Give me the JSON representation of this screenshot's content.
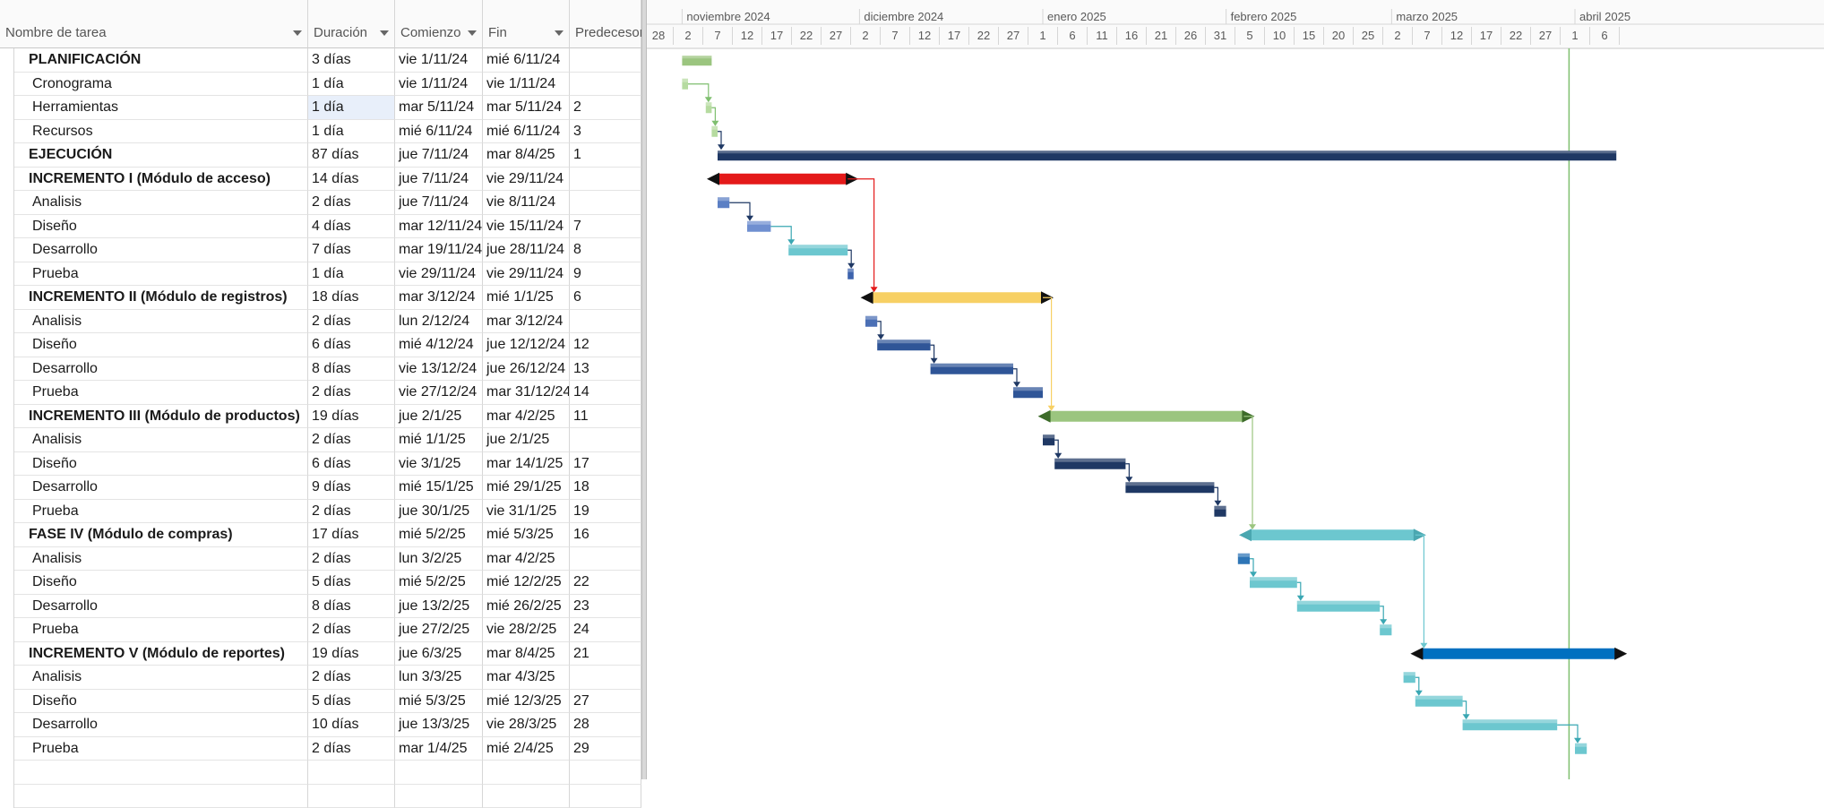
{
  "columns": {
    "name": "Nombre de tarea",
    "duration": "Duración",
    "start": "Comienzo",
    "end": "Fin",
    "pred": "Predecesora"
  },
  "timeline": {
    "months": [
      "noviembre 2024",
      "diciembre 2024",
      "enero 2025",
      "febrero 2025",
      "marzo 2025",
      "abril 2025"
    ],
    "days": [
      "28",
      "2",
      "7",
      "12",
      "17",
      "22",
      "27",
      "2",
      "7",
      "12",
      "17",
      "22",
      "27",
      "1",
      "6",
      "11",
      "16",
      "21",
      "26",
      "31",
      "5",
      "10",
      "15",
      "20",
      "25",
      "2",
      "7",
      "12",
      "17",
      "22",
      "27",
      "1",
      "6"
    ]
  },
  "tasks": [
    {
      "name": "PLANIFICACIÓN",
      "dur": "3 días",
      "start": "vie 1/11/24",
      "end": "mié 6/11/24",
      "pred": "",
      "summary": true,
      "indent": 0,
      "bar": [
        "2024-11-01",
        "2024-11-06"
      ],
      "color": "#9bc57f",
      "kind": "phase"
    },
    {
      "name": "Cronograma",
      "dur": "1 día",
      "start": "vie 1/11/24",
      "end": "vie 1/11/24",
      "pred": "",
      "summary": false,
      "indent": 1,
      "bar": [
        "2024-11-01",
        "2024-11-02"
      ],
      "color": "#b6dba0",
      "kind": "task"
    },
    {
      "name": "Herramientas",
      "dur": "1 día",
      "start": "mar 5/11/24",
      "end": "mar 5/11/24",
      "pred": "2",
      "summary": false,
      "indent": 1,
      "bar": [
        "2024-11-05",
        "2024-11-06"
      ],
      "color": "#b6dba0",
      "kind": "task",
      "selected": true
    },
    {
      "name": "Recursos",
      "dur": "1 día",
      "start": "mié 6/11/24",
      "end": "mié 6/11/24",
      "pred": "3",
      "summary": false,
      "indent": 1,
      "bar": [
        "2024-11-06",
        "2024-11-07"
      ],
      "color": "#b6dba0",
      "kind": "task"
    },
    {
      "name": "EJECUCIÓN",
      "dur": "87 días",
      "start": "jue 7/11/24",
      "end": "mar 8/4/25",
      "pred": "1",
      "summary": true,
      "indent": 0,
      "bar": [
        "2024-11-07",
        "2025-04-08"
      ],
      "color": "#1f3864",
      "kind": "phase"
    },
    {
      "name": "INCREMENTO I (Módulo de acceso)",
      "dur": "14 días",
      "start": "jue 7/11/24",
      "end": "vie 29/11/24",
      "pred": "",
      "summary": true,
      "indent": 0,
      "bar": [
        "2024-11-07",
        "2024-11-29"
      ],
      "color": "#e41a1a",
      "kind": "summary"
    },
    {
      "name": "Analisis",
      "dur": "2 días",
      "start": "jue 7/11/24",
      "end": "vie 8/11/24",
      "pred": "",
      "summary": false,
      "indent": 1,
      "bar": [
        "2024-11-07",
        "2024-11-09"
      ],
      "color": "#5b7fc4",
      "kind": "task"
    },
    {
      "name": "Diseño",
      "dur": "4 días",
      "start": "mar 12/11/24",
      "end": "vie 15/11/24",
      "pred": "7",
      "summary": false,
      "indent": 1,
      "bar": [
        "2024-11-12",
        "2024-11-16"
      ],
      "color": "#6f8fd0",
      "kind": "task"
    },
    {
      "name": "Desarrollo",
      "dur": "7 días",
      "start": "mar 19/11/24",
      "end": "jue 28/11/24",
      "pred": "8",
      "summary": false,
      "indent": 1,
      "bar": [
        "2024-11-19",
        "2024-11-29"
      ],
      "color": "#6cc7cf",
      "kind": "task"
    },
    {
      "name": "Prueba",
      "dur": "1 día",
      "start": "vie 29/11/24",
      "end": "vie 29/11/24",
      "pred": "9",
      "summary": false,
      "indent": 1,
      "bar": [
        "2024-11-29",
        "2024-11-30"
      ],
      "color": "#3d63ad",
      "kind": "task"
    },
    {
      "name": "INCREMENTO II (Módulo de registros)",
      "dur": "18 días",
      "start": "mar 3/12/24",
      "end": "mié 1/1/25",
      "pred": "6",
      "summary": true,
      "indent": 0,
      "bar": [
        "2024-12-03",
        "2025-01-01"
      ],
      "color": "#f7d064",
      "kind": "summary"
    },
    {
      "name": "Analisis",
      "dur": "2 días",
      "start": "lun 2/12/24",
      "end": "mar 3/12/24",
      "pred": "",
      "summary": false,
      "indent": 1,
      "bar": [
        "2024-12-02",
        "2024-12-04"
      ],
      "color": "#4b6fb5",
      "kind": "task"
    },
    {
      "name": "Diseño",
      "dur": "6 días",
      "start": "mié 4/12/24",
      "end": "jue 12/12/24",
      "pred": "12",
      "summary": false,
      "indent": 1,
      "bar": [
        "2024-12-04",
        "2024-12-13"
      ],
      "color": "#2f5597",
      "kind": "task"
    },
    {
      "name": "Desarrollo",
      "dur": "8 días",
      "start": "vie 13/12/24",
      "end": "jue 26/12/24",
      "pred": "13",
      "summary": false,
      "indent": 1,
      "bar": [
        "2024-12-13",
        "2024-12-27"
      ],
      "color": "#2f5597",
      "kind": "task"
    },
    {
      "name": "Prueba",
      "dur": "2 días",
      "start": "vie 27/12/24",
      "end": "mar 31/12/24",
      "pred": "14",
      "summary": false,
      "indent": 1,
      "bar": [
        "2024-12-27",
        "2025-01-01"
      ],
      "color": "#2f5597",
      "kind": "task"
    },
    {
      "name": "INCREMENTO III (Módulo de productos)",
      "dur": "19 días",
      "start": "jue 2/1/25",
      "end": "mar 4/2/25",
      "pred": "11",
      "summary": true,
      "indent": 0,
      "bar": [
        "2025-01-02",
        "2025-02-04"
      ],
      "color": "#9bc57f",
      "kind": "summary"
    },
    {
      "name": "Analisis",
      "dur": "2 días",
      "start": "mié 1/1/25",
      "end": "jue 2/1/25",
      "pred": "",
      "summary": false,
      "indent": 1,
      "bar": [
        "2025-01-01",
        "2025-01-03"
      ],
      "color": "#1f3864",
      "kind": "task"
    },
    {
      "name": "Diseño",
      "dur": "6 días",
      "start": "vie 3/1/25",
      "end": "mar 14/1/25",
      "pred": "17",
      "summary": false,
      "indent": 1,
      "bar": [
        "2025-01-03",
        "2025-01-15"
      ],
      "color": "#1f3864",
      "kind": "task"
    },
    {
      "name": "Desarrollo",
      "dur": "9 días",
      "start": "mié 15/1/25",
      "end": "mié 29/1/25",
      "pred": "18",
      "summary": false,
      "indent": 1,
      "bar": [
        "2025-01-15",
        "2025-01-30"
      ],
      "color": "#1f3864",
      "kind": "task"
    },
    {
      "name": "Prueba",
      "dur": "2 días",
      "start": "jue 30/1/25",
      "end": "vie 31/1/25",
      "pred": "19",
      "summary": false,
      "indent": 1,
      "bar": [
        "2025-01-30",
        "2025-02-01"
      ],
      "color": "#1f3864",
      "kind": "task"
    },
    {
      "name": "FASE IV (Módulo de compras)",
      "dur": "17 días",
      "start": "mié 5/2/25",
      "end": "mié 5/3/25",
      "pred": "16",
      "summary": true,
      "indent": 0,
      "bar": [
        "2025-02-05",
        "2025-03-05"
      ],
      "color": "#6cc7cf",
      "kind": "summary"
    },
    {
      "name": "Analisis",
      "dur": "2 días",
      "start": "lun 3/2/25",
      "end": "mar 4/2/25",
      "pred": "",
      "summary": false,
      "indent": 1,
      "bar": [
        "2025-02-03",
        "2025-02-05"
      ],
      "color": "#2e75b6",
      "kind": "task"
    },
    {
      "name": "Diseño",
      "dur": "5 días",
      "start": "mié 5/2/25",
      "end": "mié 12/2/25",
      "pred": "22",
      "summary": false,
      "indent": 1,
      "bar": [
        "2025-02-05",
        "2025-02-13"
      ],
      "color": "#6cc7cf",
      "kind": "task"
    },
    {
      "name": "Desarrollo",
      "dur": "8 días",
      "start": "jue 13/2/25",
      "end": "mié 26/2/25",
      "pred": "23",
      "summary": false,
      "indent": 1,
      "bar": [
        "2025-02-13",
        "2025-02-27"
      ],
      "color": "#6cc7cf",
      "kind": "task"
    },
    {
      "name": "Prueba",
      "dur": "2 días",
      "start": "jue 27/2/25",
      "end": "vie 28/2/25",
      "pred": "24",
      "summary": false,
      "indent": 1,
      "bar": [
        "2025-02-27",
        "2025-03-01"
      ],
      "color": "#6cc7cf",
      "kind": "task"
    },
    {
      "name": "INCREMENTO V (Módulo de reportes)",
      "dur": "19 días",
      "start": "jue 6/3/25",
      "end": "mar 8/4/25",
      "pred": "21",
      "summary": true,
      "indent": 0,
      "bar": [
        "2025-03-06",
        "2025-04-08"
      ],
      "color": "#0070c0",
      "kind": "summary"
    },
    {
      "name": "Analisis",
      "dur": "2 días",
      "start": "lun 3/3/25",
      "end": "mar 4/3/25",
      "pred": "",
      "summary": false,
      "indent": 1,
      "bar": [
        "2025-03-03",
        "2025-03-05"
      ],
      "color": "#6cc7cf",
      "kind": "task"
    },
    {
      "name": "Diseño",
      "dur": "5 días",
      "start": "mié 5/3/25",
      "end": "mié 12/3/25",
      "pred": "27",
      "summary": false,
      "indent": 1,
      "bar": [
        "2025-03-05",
        "2025-03-13"
      ],
      "color": "#6cc7cf",
      "kind": "task"
    },
    {
      "name": "Desarrollo",
      "dur": "10 días",
      "start": "jue 13/3/25",
      "end": "vie 28/3/25",
      "pred": "28",
      "summary": false,
      "indent": 1,
      "bar": [
        "2025-03-13",
        "2025-03-29"
      ],
      "color": "#6cc7cf",
      "kind": "task"
    },
    {
      "name": "Prueba",
      "dur": "2 días",
      "start": "mar 1/4/25",
      "end": "mié 2/4/25",
      "pred": "29",
      "summary": false,
      "indent": 1,
      "bar": [
        "2025-04-01",
        "2025-04-03"
      ],
      "color": "#6cc7cf",
      "kind": "task"
    }
  ],
  "links": [
    [
      1,
      2
    ],
    [
      2,
      3
    ],
    [
      3,
      4
    ],
    [
      6,
      7
    ],
    [
      7,
      8
    ],
    [
      8,
      9
    ],
    [
      5,
      10
    ],
    [
      11,
      12
    ],
    [
      12,
      13
    ],
    [
      13,
      14
    ],
    [
      10,
      15
    ],
    [
      16,
      17
    ],
    [
      17,
      18
    ],
    [
      18,
      19
    ],
    [
      15,
      20
    ],
    [
      21,
      22
    ],
    [
      22,
      23
    ],
    [
      23,
      24
    ],
    [
      20,
      25
    ],
    [
      26,
      27
    ],
    [
      27,
      28
    ],
    [
      28,
      29
    ]
  ],
  "today": "2025-03-31",
  "colors": {
    "today_line": "#7fbf6f",
    "header_bg": "#fafafa"
  }
}
